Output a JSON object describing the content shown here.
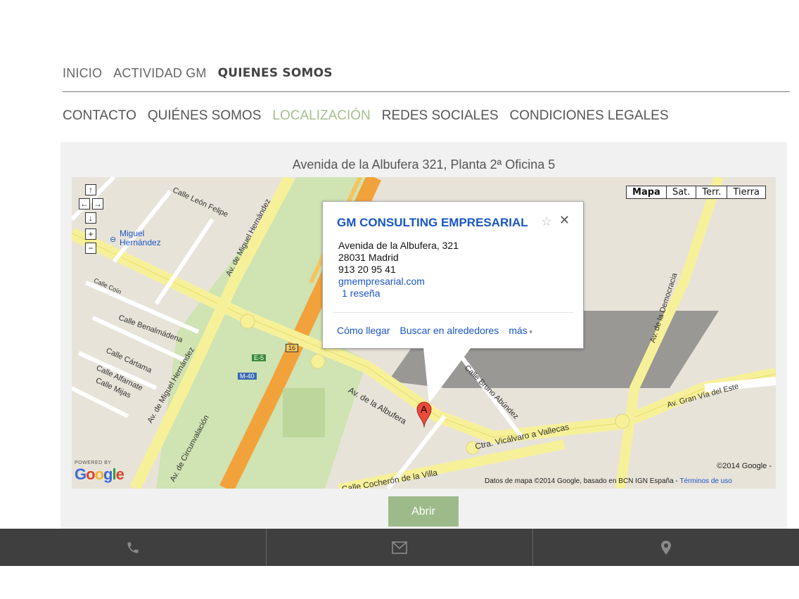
{
  "top_nav": [
    "INICIO",
    "ACTIVIDAD GM",
    "QUIENES SOMOS"
  ],
  "sub_nav": [
    "CONTACTO",
    "QUIÉNES SOMOS",
    "LOCALIZACIÓN",
    "REDES SOCIALES",
    "CONDICIONES LEGALES"
  ],
  "address_heading": "Avenida de la Albufera 321, Planta 2ª Oficina 5",
  "map": {
    "map_types": [
      "Mapa",
      "Sat.",
      "Terr.",
      "Tierra"
    ],
    "controls": [
      "↑",
      "←",
      "→",
      "↓",
      "+",
      "−"
    ],
    "popup": {
      "name": "GM CONSULTING EMPRESARIAL",
      "line1": "Avenida de la Albufera, 321",
      "line2": "28031 Madrid",
      "phone": "913 20 95 41",
      "website": "gmempresarial.com",
      "reviews": "1 reseña",
      "actions": [
        "Cómo llegar",
        "Buscar en alrededores",
        "más"
      ]
    },
    "marker": "A",
    "labels": {
      "metro": "Miguel Hernández",
      "leon": "Calle León Felipe",
      "mh": "Av. de Miguel Hernández",
      "albufera": "Av. de la Albufera",
      "vicalvaro": "Ctra. Vicálvaro a Vallecas",
      "democracia": "Av. de la Democracia",
      "granvia": "Av. Gran Vía del Este",
      "cocheron": "Calle Cocherón de la Villa",
      "circ": "Av. de Circunvalación",
      "benal": "Calle Benalmádena",
      "cartama": "Calle Cártama",
      "alfarnate": "Calle Alfarnate",
      "mijas": "Calle Mijas",
      "bruno": "Calle Bruno Abúndez",
      "coin": "Calle Coín",
      "e5": "E-5",
      "m40": "M-40",
      "n16": "16"
    },
    "attribution": "Datos de mapa ©2014 Google, basado en BCN IGN España -",
    "terms": "Términos de uso",
    "copyright": "©2014 Google -",
    "powered_by": "POWERED BY",
    "google": "Google"
  },
  "open_button": "Abrir",
  "footer_icons": [
    "phone-icon",
    "envelope-icon",
    "map-pin-icon"
  ]
}
